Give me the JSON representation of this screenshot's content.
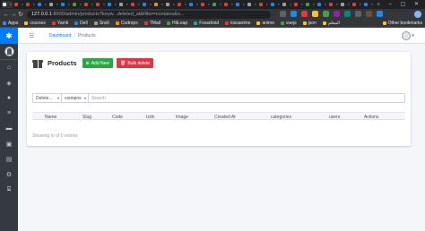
{
  "browser": {
    "url_host": "127.0.0.1",
    "url_path": ":8000/admin/products?keyw...deleted_at&filter=contains&o...",
    "bookmarks": [
      "Apps",
      "courses",
      "Yamli",
      "Dell",
      "Snclt",
      "Codrops",
      "TMail",
      "HitLeap",
      "Fossdroid",
      "kissanime",
      "anime",
      "vuejs",
      "json",
      "المعلم"
    ],
    "other_bookmarks": "Other bookmarks",
    "tab_colors": [
      "#e8eaed",
      "#e53935",
      "#e53935",
      "#1e88e5",
      "#9e9e9e",
      "#1e88e5",
      "#43a047",
      "#e53935",
      "#e53935",
      "#1e88e5",
      "#9e9e9e",
      "#e53935",
      "#1e88e5",
      "#fb8c00",
      "#9e9e9e",
      "#e53935",
      "#1e88e5",
      "#e53935",
      "#43a047",
      "#e53935",
      "#1e88e5",
      "#9e9e9e",
      "#e53935",
      "#1e88e5",
      "#9e9e9e",
      "#e53935",
      "#43a047",
      "#1e88e5",
      "#e53935",
      "#9e9e9e",
      "#e53935",
      "#1e88e5"
    ]
  },
  "breadcrumb": {
    "home": "Dashboard",
    "current": "Products"
  },
  "page": {
    "title": "Products",
    "add_button": "Add New",
    "bulk_delete_button": "Bulk delete"
  },
  "filter": {
    "field_value": "Delete...",
    "operator_value": "contains",
    "search_placeholder": "Search"
  },
  "table": {
    "columns": [
      "Name",
      "Slug",
      "Code",
      "Izdn",
      "Image",
      "Created At",
      "categories",
      "users",
      "Actions"
    ],
    "info": "Showing to of 0 entries"
  },
  "colors": {
    "primary": "#007bff",
    "success": "#28a745",
    "danger": "#dc3545",
    "sidebar": "#343a40"
  }
}
